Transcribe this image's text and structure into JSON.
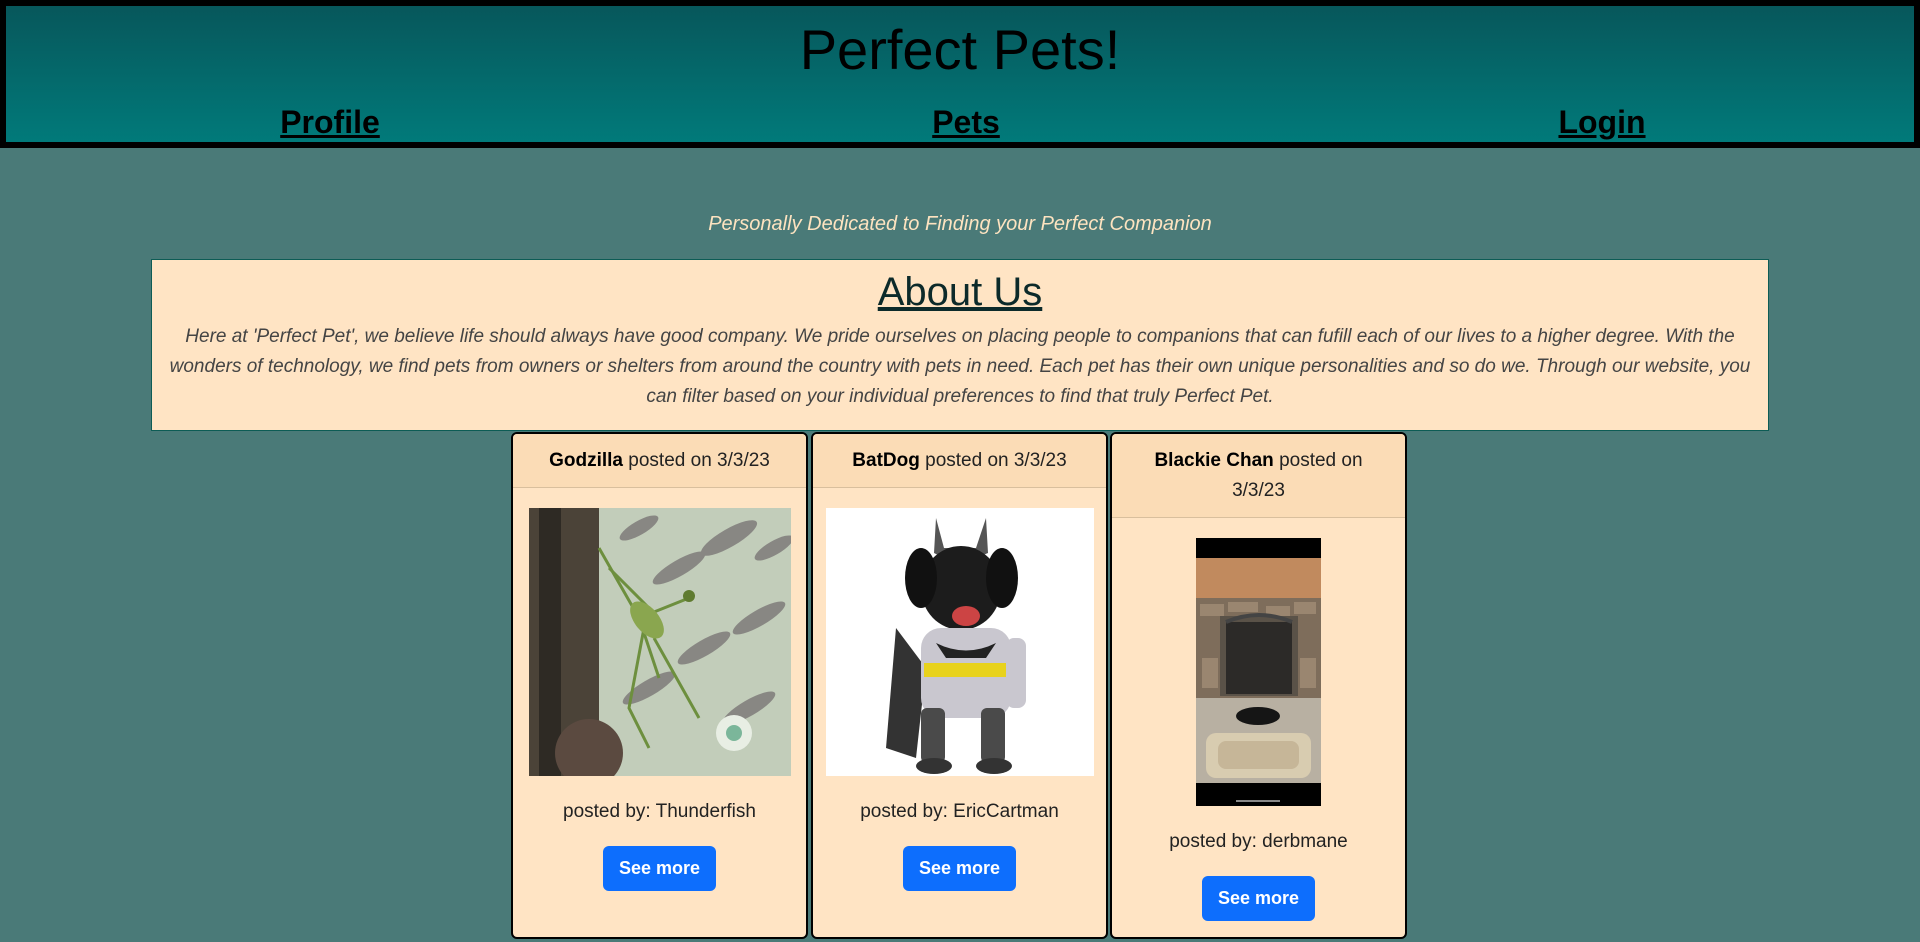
{
  "header": {
    "title": "Perfect Pets!",
    "nav": [
      {
        "label": "Profile"
      },
      {
        "label": "Pets"
      },
      {
        "label": "Login"
      }
    ]
  },
  "tagline": "Personally Dedicated to Finding your Perfect Companion",
  "about": {
    "title": "About Us",
    "text": "Here at 'Perfect Pet', we believe life should always have good company. We pride ourselves on placing people to companions that can fufill each of our lives to a higher degree. With the wonders of technology, we find pets from owners or shelters from around the country with pets in need. Each pet has their own unique personalities and so do we. Through our website, you can filter based on your individual preferences to find that truly Perfect Pet."
  },
  "posts": [
    {
      "name": "Godzilla",
      "posted_on": "posted on 3/3/23",
      "posted_by": "posted by: Thunderfish",
      "button": "See more"
    },
    {
      "name": "BatDog",
      "posted_on": "posted on 3/3/23",
      "posted_by": "posted by: EricCartman",
      "button": "See more"
    },
    {
      "name": "Blackie Chan",
      "posted_on": "posted on 3/3/23",
      "posted_by": "posted by: derbmane",
      "button": "See more"
    }
  ],
  "colors": {
    "header_top": "#07575b",
    "header_bottom": "#017a7a",
    "page_bg": "#4a7a78",
    "card_bg": "#ffe4c4",
    "button": "#0d6efd"
  }
}
